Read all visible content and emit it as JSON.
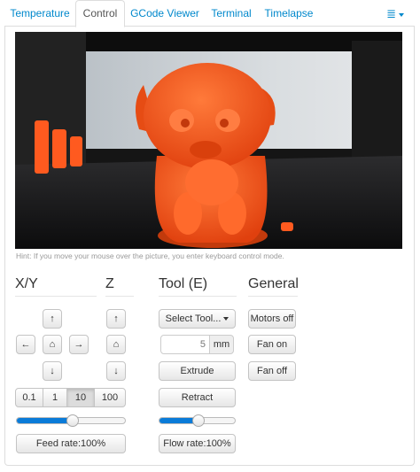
{
  "tabs": [
    {
      "label": "Temperature",
      "active": false
    },
    {
      "label": "Control",
      "active": true
    },
    {
      "label": "GCode Viewer",
      "active": false
    },
    {
      "label": "Terminal",
      "active": false
    },
    {
      "label": "Timelapse",
      "active": false
    }
  ],
  "tab_menu_icon": "list-menu-icon",
  "webcam": {
    "subject": "orange 3D-printed dog figure",
    "hint": "Hint: If you move your mouse over the picture, you enter keyboard control mode."
  },
  "sections": {
    "xy": "X/Y",
    "z": "Z",
    "tool": "Tool (E)",
    "general": "General"
  },
  "jog": {
    "up": "↑",
    "down": "↓",
    "left": "←",
    "right": "→",
    "home": "⌂",
    "z_up": "↑",
    "z_down": "↓",
    "z_home": "⌂"
  },
  "step_sizes": {
    "options": [
      "0.1",
      "1",
      "10",
      "100"
    ],
    "selected": "10"
  },
  "feed_rate": {
    "label": "Feed rate:100%",
    "value_percent": 100,
    "slider_fraction": 0.52
  },
  "tool": {
    "select_label": "Select Tool...",
    "amount_value": "5",
    "amount_unit": "mm",
    "extrude_label": "Extrude",
    "retract_label": "Retract",
    "flow_rate": {
      "label": "Flow rate:100%",
      "value_percent": 100,
      "slider_fraction": 0.52
    }
  },
  "general": {
    "motors_off": "Motors off",
    "fan_on": "Fan on",
    "fan_off": "Fan off"
  },
  "colors": {
    "accent": "#0a7bd8",
    "link": "#0088cc",
    "print_orange": "#ff5a1f"
  }
}
